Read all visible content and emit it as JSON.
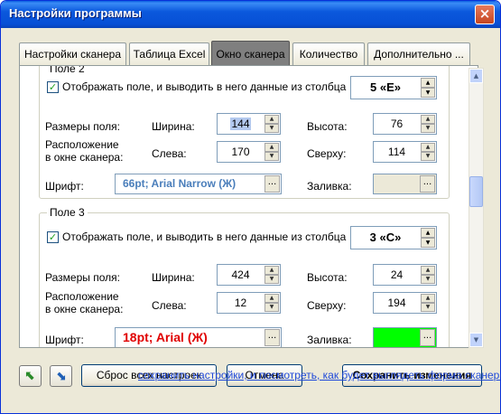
{
  "window": {
    "title": "Настройки программы",
    "close": "×"
  },
  "tabs": [
    "Настройки сканера",
    "Таблица Excel",
    "Окно сканера",
    "Количество",
    "Дополнительно ..."
  ],
  "field2": {
    "title": "Поле 2",
    "show_label": "Отображать поле, и выводить в него данные из столбца",
    "column": "5 «E»",
    "size_label": "Размеры поля:",
    "width_label": "Ширина:",
    "width": "144",
    "height_label": "Высота:",
    "height": "76",
    "pos_label_1": "Расположение",
    "pos_label_2": "в окне сканера:",
    "left_label": "Слева:",
    "left": "170",
    "top_label": "Сверху:",
    "top": "114",
    "font_label": "Шрифт:",
    "font": "66pt; Arial Narrow (Ж)",
    "font_color": "#4a7ebb",
    "fill_label": "Заливка:",
    "fill_color": "#ece9d8"
  },
  "field3": {
    "title": "Поле 3",
    "show_label": "Отображать поле, и выводить в него данные из столбца",
    "column": "3 «C»",
    "size_label": "Размеры поля:",
    "width_label": "Ширина:",
    "width": "424",
    "height_label": "Высота:",
    "height": "24",
    "pos_label_1": "Расположение",
    "pos_label_2": "в окне сканера:",
    "left_label": "Слева:",
    "left": "12",
    "top_label": "Сверху:",
    "top": "194",
    "font_label": "Шрифт:",
    "font": "18pt; Arial (Ж)",
    "font_color": "#e00000",
    "fill_label": "Заливка:",
    "fill_color": "#00ff00"
  },
  "buttons": {
    "reset": "Сброс всех настроек",
    "cancel": "Отмена",
    "save": "Сохранить изменения",
    "dots": "..."
  },
  "link": "сохранить настройки, и посмотреть, как будет выглядеть форма сканера"
}
